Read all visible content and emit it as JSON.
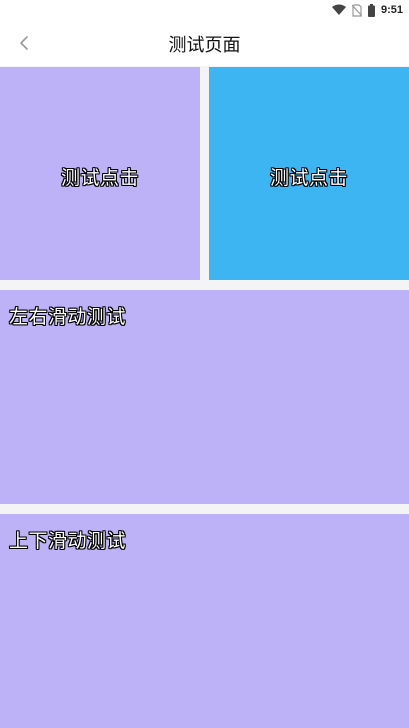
{
  "status_bar": {
    "time": "9:51",
    "icons": [
      "wifi-icon",
      "no-sim-icon",
      "battery-icon"
    ]
  },
  "nav": {
    "back_icon": "chevron-left-icon",
    "title": "测试页面"
  },
  "tiles": [
    {
      "label": "测试点击",
      "color": "#bdb2f8"
    },
    {
      "label": "测试点击",
      "color": "#3db5f2"
    }
  ],
  "panels": {
    "horizontal": {
      "label": "左右滑动测试",
      "color": "#bdb2f8"
    },
    "vertical": {
      "label": "上下滑动测试",
      "color": "#bdb2f8"
    }
  }
}
